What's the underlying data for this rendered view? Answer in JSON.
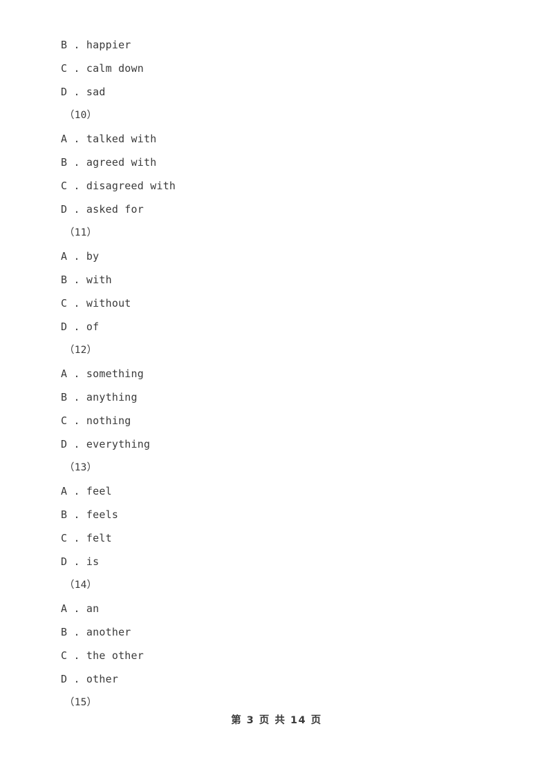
{
  "page": {
    "background_color": "#ffffff",
    "text_color": "#3a3a3a"
  },
  "content": {
    "lines": [
      {
        "kind": "option",
        "text": "B . happier"
      },
      {
        "kind": "option",
        "text": "C . calm down"
      },
      {
        "kind": "option",
        "text": "D . sad"
      },
      {
        "kind": "qnum",
        "text": "（10）"
      },
      {
        "kind": "option",
        "text": "A . talked with"
      },
      {
        "kind": "option",
        "text": "B . agreed with"
      },
      {
        "kind": "option",
        "text": "C . disagreed with"
      },
      {
        "kind": "option",
        "text": "D . asked for"
      },
      {
        "kind": "qnum",
        "text": "（11）"
      },
      {
        "kind": "option",
        "text": "A . by"
      },
      {
        "kind": "option",
        "text": "B . with"
      },
      {
        "kind": "option",
        "text": "C . without"
      },
      {
        "kind": "option",
        "text": "D . of"
      },
      {
        "kind": "qnum",
        "text": "（12）"
      },
      {
        "kind": "option",
        "text": "A . something"
      },
      {
        "kind": "option",
        "text": "B . anything"
      },
      {
        "kind": "option",
        "text": "C . nothing"
      },
      {
        "kind": "option",
        "text": "D . everything"
      },
      {
        "kind": "qnum",
        "text": "（13）"
      },
      {
        "kind": "option",
        "text": "A . feel"
      },
      {
        "kind": "option",
        "text": "B . feels"
      },
      {
        "kind": "option",
        "text": "C . felt"
      },
      {
        "kind": "option",
        "text": "D . is"
      },
      {
        "kind": "qnum",
        "text": "（14）"
      },
      {
        "kind": "option",
        "text": "A . an"
      },
      {
        "kind": "option",
        "text": "B . another"
      },
      {
        "kind": "option",
        "text": "C . the other"
      },
      {
        "kind": "option",
        "text": "D . other"
      },
      {
        "kind": "qnum",
        "text": "（15）"
      }
    ]
  },
  "footer": {
    "text": "第 3 页 共 14 页",
    "current_page": "3",
    "total_pages": "14"
  }
}
